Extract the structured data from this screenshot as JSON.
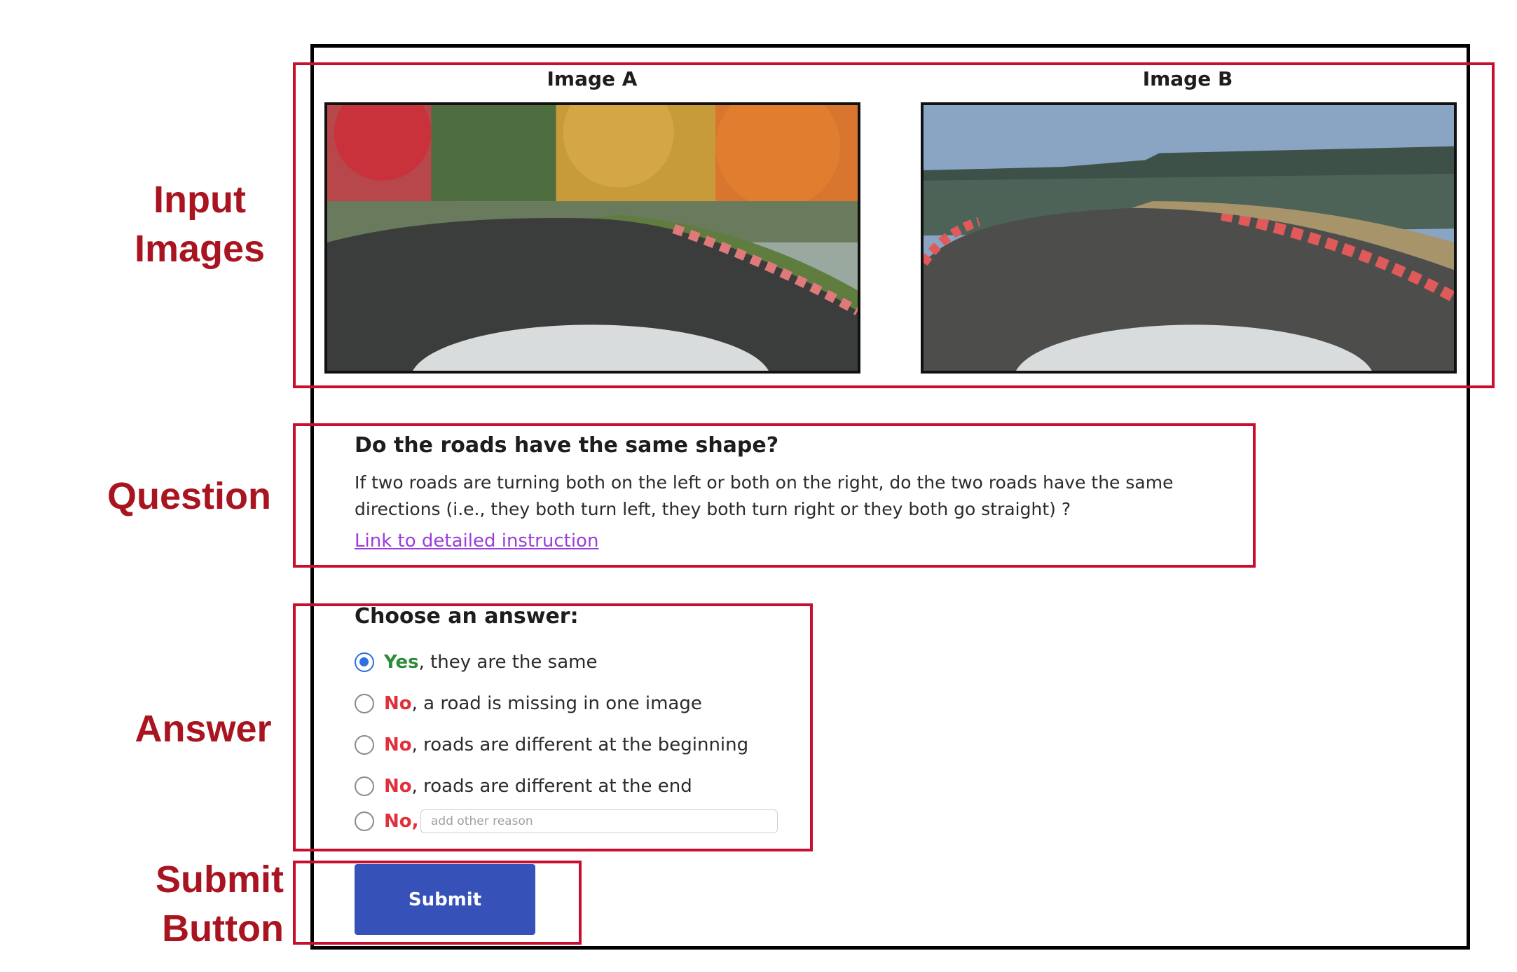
{
  "labels": {
    "input_images": [
      "Input",
      "Images"
    ],
    "question": "Question",
    "answer": "Answer",
    "submit_button": [
      "Submit",
      "Button"
    ]
  },
  "images": {
    "a_title": "Image A",
    "b_title": "Image B"
  },
  "question": {
    "title": "Do the roads have the same shape?",
    "description": "If two roads are turning both on the left or both on the right, do the two roads have the same directions (i.e., they both turn left, they both turn right or they both go straight) ?",
    "link_text": "Link to detailed instruction"
  },
  "answer": {
    "title": "Choose an answer:",
    "options": [
      {
        "lead": "Yes",
        "text": ", they are the same",
        "selected": true
      },
      {
        "lead": "No",
        "text": ", a road is missing in one image",
        "selected": false
      },
      {
        "lead": "No",
        "text": ", roads are different at the beginning",
        "selected": false
      },
      {
        "lead": "No",
        "text": ", roads are different at the end",
        "selected": false
      },
      {
        "lead": "No",
        "text": ",",
        "selected": false
      }
    ],
    "other_placeholder": "add other reason"
  },
  "submit_label": "Submit",
  "colors": {
    "annotation_red": "#c8102e",
    "label_red": "#a8141f",
    "yes_green": "#2e8b3a",
    "no_red": "#e0303b",
    "radio_blue": "#2f6fe0",
    "submit_blue": "#3651b8",
    "link_purple": "#9b3ed9"
  }
}
